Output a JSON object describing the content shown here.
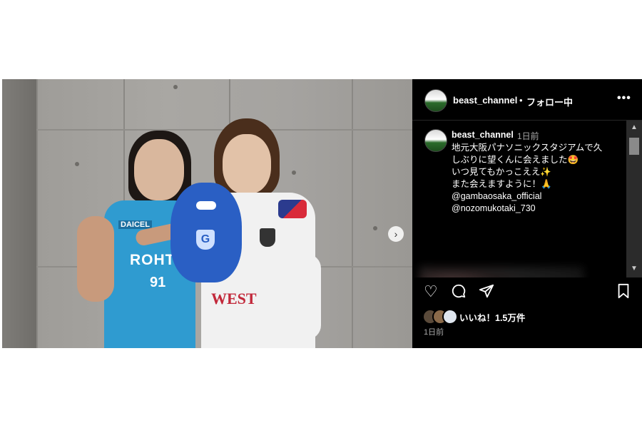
{
  "header": {
    "username": "beast_channel",
    "separator": "•",
    "follow_status": "フォロー中",
    "more_icon": "more-horizontal-icon"
  },
  "caption": {
    "username": "beast_channel",
    "time": "1日前",
    "lines": [
      "地元大阪パナソニックスタジアムで久",
      "しぶりに望くんに会えました🤩",
      "いつ見てもかっこええ✨",
      "また会えますように！🙏",
      "@gambaosaka_official",
      "@nozomukotaki_730"
    ]
  },
  "photo": {
    "jersey_text_left": "ROHTO",
    "jersey_number": "91",
    "sponsor_left": "DAICEL",
    "jersey_text_right": "WEST"
  },
  "actions": {
    "like_icon": "heart-icon",
    "comment_icon": "comment-icon",
    "share_icon": "send-icon",
    "save_icon": "bookmark-icon"
  },
  "likes": {
    "text": "いいね！1.5万件"
  },
  "post_date": "1日前",
  "colors": {
    "background": "#000000",
    "text": "#ffffff",
    "muted": "#a8a8a8",
    "jersey_blue": "#2f9bd0",
    "mascot_blue": "#2a5fc4"
  }
}
